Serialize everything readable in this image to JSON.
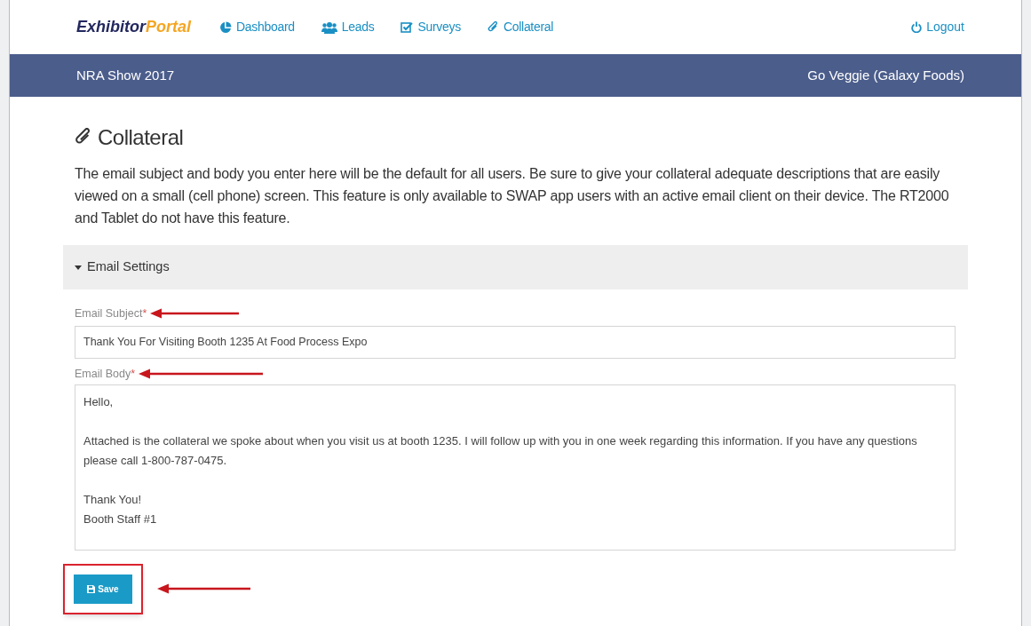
{
  "navbar": {
    "brand": {
      "part_1": "Exhibitor",
      "part_2": "Portal"
    },
    "links": [
      {
        "label": "Dashboard"
      },
      {
        "label": "Leads"
      },
      {
        "label": "Surveys"
      },
      {
        "label": "Collateral"
      }
    ],
    "logout": "Logout"
  },
  "show_bar": {
    "event": "NRA Show 2017",
    "exhibitor": "Go Veggie (Galaxy Foods)"
  },
  "page": {
    "title": "Collateral",
    "description": "The email subject and body you enter here will be the default for all users. Be sure to give your collateral adequate descriptions that are easily viewed on a small (cell phone) screen. This feature is only available to SWAP app users with an active email client on their device. The RT2000 and Tablet do not have this feature."
  },
  "section": {
    "title": "Email Settings",
    "expanded": true
  },
  "fields": [
    {
      "label": "Email Subject",
      "required": "*",
      "kind": "input",
      "value": "Thank You For Visiting Booth 1235 At Food Process Expo"
    },
    {
      "label": "Email Body",
      "required": "*",
      "kind": "textarea",
      "value": "Hello,\n\nAttached is the collateral we spoke about when you visit us at booth 1235. I will follow up with you in one week regarding this information. If you have any questions please call 1-800-787-0475.\n\nThank You!\nBooth Staff #1"
    }
  ],
  "save_button": "Save"
}
